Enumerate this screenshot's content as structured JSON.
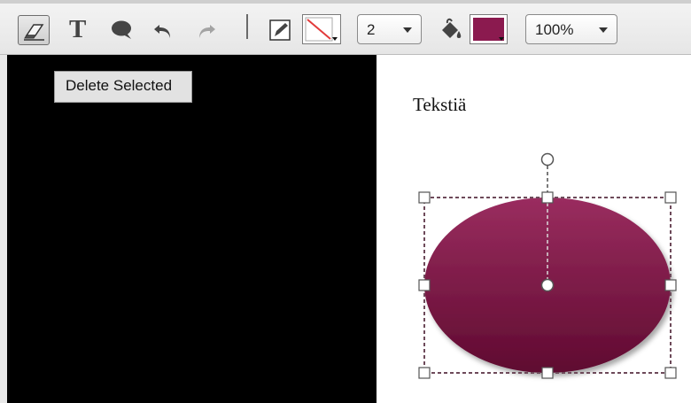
{
  "toolbar": {
    "tools": [
      {
        "name": "eraser-icon",
        "label": ""
      },
      {
        "name": "text-tool-icon",
        "glyph": "T"
      },
      {
        "name": "speech-bubble-icon"
      },
      {
        "name": "undo-icon"
      },
      {
        "name": "redo-icon"
      }
    ],
    "stroke_width": "2",
    "zoom": "100%",
    "colors": {
      "fill": "#8b1a4f",
      "line": "#e23b3b",
      "shape_top": "#9a2d5f",
      "shape_bottom": "#5f0a30"
    }
  },
  "tooltip": {
    "text": "Delete Selected"
  },
  "canvas": {
    "text": "Tekstiä"
  }
}
